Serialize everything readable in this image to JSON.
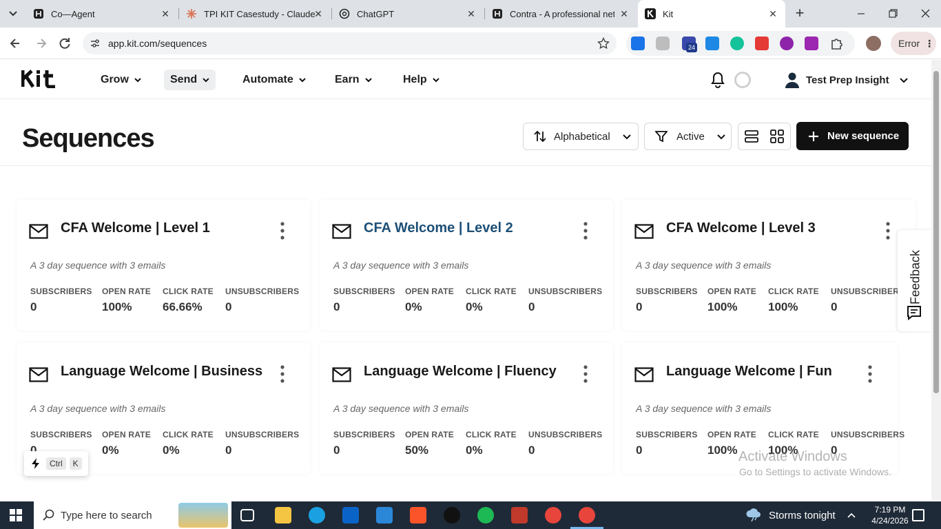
{
  "browser": {
    "tabs": [
      {
        "title": "Co—Agent"
      },
      {
        "title": "TPI KIT Casestudy - Claude"
      },
      {
        "title": "ChatGPT"
      },
      {
        "title": "Contra - A professional netw"
      },
      {
        "title": "Kit"
      }
    ],
    "url": "app.kit.com/sequences",
    "profile_status": "Error",
    "ext_badge": "24"
  },
  "app": {
    "logo": "Kit",
    "nav": [
      {
        "label": "Grow"
      },
      {
        "label": "Send"
      },
      {
        "label": "Automate"
      },
      {
        "label": "Earn"
      },
      {
        "label": "Help"
      }
    ],
    "account_name": "Test Prep Insight"
  },
  "page": {
    "title": "Sequences",
    "sort_label": "Alphabetical",
    "filter_label": "Active",
    "new_button": "New sequence"
  },
  "stat_labels": {
    "subscribers": "SUBSCRIBERS",
    "open_rate": "OPEN RATE",
    "click_rate": "CLICK RATE",
    "unsubscribers": "UNSUBSCRIBERS"
  },
  "cards": [
    {
      "title": "CFA Welcome | Level 1",
      "desc": "A 3 day sequence with 3 emails",
      "subscribers": "0",
      "open_rate": "100%",
      "click_rate": "66.66%",
      "unsubscribers": "0"
    },
    {
      "title": "CFA Welcome | Level 2",
      "desc": "A 3 day sequence with 3 emails",
      "subscribers": "0",
      "open_rate": "0%",
      "click_rate": "0%",
      "unsubscribers": "0"
    },
    {
      "title": "CFA Welcome | Level 3",
      "desc": "A 3 day sequence with 3 emails",
      "subscribers": "0",
      "open_rate": "100%",
      "click_rate": "100%",
      "unsubscribers": "0"
    },
    {
      "title": "Language Welcome | Business",
      "desc": "A 3 day sequence with 3 emails",
      "subscribers": "0",
      "open_rate": "0%",
      "click_rate": "0%",
      "unsubscribers": "0"
    },
    {
      "title": "Language Welcome | Fluency",
      "desc": "A 3 day sequence with 3 emails",
      "subscribers": "0",
      "open_rate": "50%",
      "click_rate": "0%",
      "unsubscribers": "0"
    },
    {
      "title": "Language Welcome | Fun",
      "desc": "A 3 day sequence with 3 emails",
      "subscribers": "0",
      "open_rate": "100%",
      "click_rate": "100%",
      "unsubscribers": "0"
    }
  ],
  "feedback": {
    "label": "Feedback"
  },
  "shortcut": {
    "key1": "Ctrl",
    "key2": "K"
  },
  "watermark": {
    "line1": "Activate Windows",
    "line2": "Go to Settings to activate Windows."
  },
  "taskbar": {
    "search_placeholder": "Type here to search",
    "weather": "Storms tonight",
    "time": "7:19 PM",
    "date": "4/24/2026"
  }
}
